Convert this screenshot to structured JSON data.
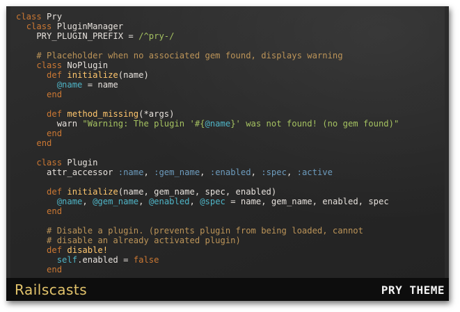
{
  "editor": {
    "lines": [
      [
        [
          "kw",
          "class "
        ],
        [
          "tx",
          "Pry"
        ]
      ],
      [
        [
          "tx",
          "  "
        ],
        [
          "kw",
          "class "
        ],
        [
          "tx",
          "PluginManager"
        ]
      ],
      [
        [
          "tx",
          "    PRY_PLUGIN_PREFIX = "
        ],
        [
          "str",
          "/^pry-/"
        ]
      ],
      [
        [
          "tx",
          ""
        ]
      ],
      [
        [
          "tx",
          "    "
        ],
        [
          "cm",
          "# Placeholder when no associated gem found, displays warning"
        ]
      ],
      [
        [
          "tx",
          "    "
        ],
        [
          "kw",
          "class "
        ],
        [
          "tx",
          "NoPlugin"
        ]
      ],
      [
        [
          "tx",
          "      "
        ],
        [
          "kw",
          "def "
        ],
        [
          "fn",
          "initialize"
        ],
        [
          "tx",
          "(name)"
        ]
      ],
      [
        [
          "tx",
          "        "
        ],
        [
          "ivar",
          "@name"
        ],
        [
          "tx",
          " = name"
        ]
      ],
      [
        [
          "tx",
          "      "
        ],
        [
          "kw",
          "end"
        ]
      ],
      [
        [
          "tx",
          ""
        ]
      ],
      [
        [
          "tx",
          "      "
        ],
        [
          "kw",
          "def "
        ],
        [
          "fn",
          "method_missing"
        ],
        [
          "tx",
          "(*args)"
        ]
      ],
      [
        [
          "tx",
          "        warn "
        ],
        [
          "str",
          "\"Warning: The plugin '#{"
        ],
        [
          "ivar",
          "@name"
        ],
        [
          "str",
          "}' was not found! (no gem found)\""
        ]
      ],
      [
        [
          "tx",
          "      "
        ],
        [
          "kw",
          "end"
        ]
      ],
      [
        [
          "tx",
          "    "
        ],
        [
          "kw",
          "end"
        ]
      ],
      [
        [
          "tx",
          ""
        ]
      ],
      [
        [
          "tx",
          "    "
        ],
        [
          "kw",
          "class "
        ],
        [
          "tx",
          "Plugin"
        ]
      ],
      [
        [
          "tx",
          "      attr_accessor "
        ],
        [
          "sym",
          ":name"
        ],
        [
          "tx",
          ", "
        ],
        [
          "sym",
          ":gem_name"
        ],
        [
          "tx",
          ", "
        ],
        [
          "sym",
          ":enabled"
        ],
        [
          "tx",
          ", "
        ],
        [
          "sym",
          ":spec"
        ],
        [
          "tx",
          ", "
        ],
        [
          "sym",
          ":active"
        ]
      ],
      [
        [
          "tx",
          ""
        ]
      ],
      [
        [
          "tx",
          "      "
        ],
        [
          "kw",
          "def "
        ],
        [
          "fn",
          "initialize"
        ],
        [
          "tx",
          "(name, gem_name, spec, enabled)"
        ]
      ],
      [
        [
          "tx",
          "        "
        ],
        [
          "ivar",
          "@name"
        ],
        [
          "tx",
          ", "
        ],
        [
          "ivar",
          "@gem_name"
        ],
        [
          "tx",
          ", "
        ],
        [
          "ivar",
          "@enabled"
        ],
        [
          "tx",
          ", "
        ],
        [
          "ivar",
          "@spec"
        ],
        [
          "tx",
          " = name, gem_name, enabled, spec"
        ]
      ],
      [
        [
          "tx",
          "      "
        ],
        [
          "kw",
          "end"
        ]
      ],
      [
        [
          "tx",
          ""
        ]
      ],
      [
        [
          "tx",
          "      "
        ],
        [
          "cm",
          "# Disable a plugin. (prevents plugin from being loaded, cannot"
        ]
      ],
      [
        [
          "tx",
          "      "
        ],
        [
          "cm",
          "# disable an already activated plugin)"
        ]
      ],
      [
        [
          "tx",
          "      "
        ],
        [
          "kw",
          "def "
        ],
        [
          "fn",
          "disable!"
        ]
      ],
      [
        [
          "tx",
          "        "
        ],
        [
          "ivar",
          "self"
        ],
        [
          "tx",
          ".enabled = "
        ],
        [
          "kw",
          "false"
        ]
      ],
      [
        [
          "tx",
          "      "
        ],
        [
          "kw",
          "end"
        ]
      ]
    ]
  },
  "footer": {
    "theme_name": "Railscasts",
    "brand": "PRY THEME"
  }
}
